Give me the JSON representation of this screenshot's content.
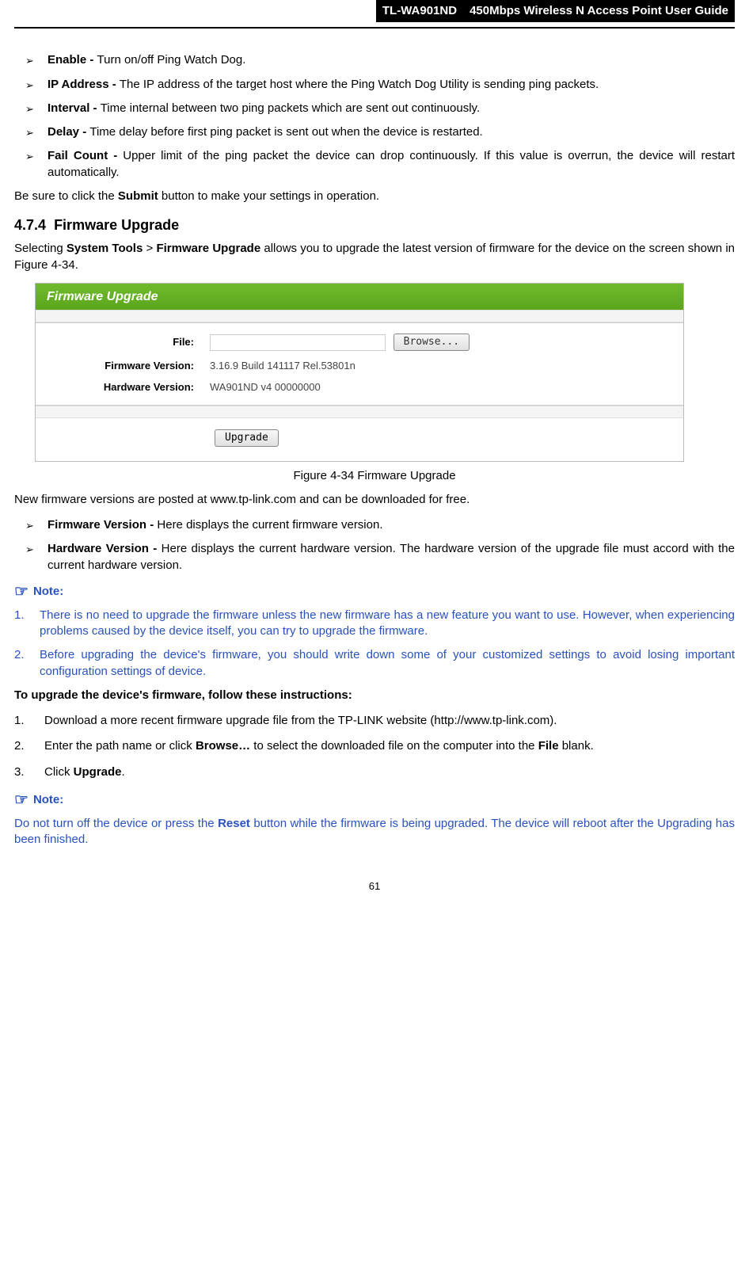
{
  "header": {
    "model": "TL-WA901ND",
    "title": "450Mbps Wireless N Access Point User Guide"
  },
  "bullets1": [
    {
      "term": "Enable - ",
      "desc": "Turn on/off Ping Watch Dog."
    },
    {
      "term": "IP Address - ",
      "desc": "The IP address of the target host where the Ping Watch Dog Utility is sending ping packets."
    },
    {
      "term": "Interval - ",
      "desc": "Time internal between two ping packets which are sent out continuously."
    },
    {
      "term": "Delay - ",
      "desc": "Time delay before first ping packet is sent out when the device is restarted."
    },
    {
      "term": "Fail Count - ",
      "desc": "Upper limit of the ping packet the device can drop continuously. If this value is overrun, the device will restart automatically."
    }
  ],
  "submit_line_a": "Be sure to click the ",
  "submit_bold": "Submit",
  "submit_line_b": " button to make your settings in operation.",
  "section_num": "4.7.4",
  "section_title": "Firmware Upgrade",
  "intro_a": "Selecting ",
  "intro_b": "System Tools",
  "intro_c": " > ",
  "intro_d": "Firmware Upgrade",
  "intro_e": " allows you to upgrade the latest version of firmware for the device on the screen shown in Figure 4-34.",
  "figure": {
    "panel_title": "Firmware Upgrade",
    "file_label": "File:",
    "browse_btn": "Browse...",
    "fw_label": "Firmware Version:",
    "fw_value": "3.16.9 Build 141117 Rel.53801n",
    "hw_label": "Hardware Version:",
    "hw_value": "WA901ND v4 00000000",
    "upgrade_btn": "Upgrade",
    "caption": "Figure 4-34 Firmware Upgrade"
  },
  "after_fig": "New firmware versions are posted at www.tp-link.com and can be downloaded for free.",
  "bullets2": [
    {
      "term": "Firmware Version - ",
      "desc": "Here displays the current firmware version."
    },
    {
      "term": "Hardware Version - ",
      "desc": "Here displays the current hardware version. The hardware version of the upgrade file must accord with the current hardware version."
    }
  ],
  "note_label": "Note:",
  "notes1": [
    "There is no need to upgrade the firmware unless the new firmware has a new feature you want to use. However, when experiencing problems caused by the device itself, you can try to upgrade the firmware.",
    "Before upgrading the device's firmware, you should write down some of your customized settings to avoid losing important configuration settings of device."
  ],
  "instructions_title": "To upgrade the device's firmware, follow these instructions:",
  "steps": [
    {
      "pre": "Download a more recent firmware upgrade file from the TP-LINK website (http://www.tp-link.com)."
    },
    {
      "pre": "Enter the path name or click ",
      "b1": "Browse…",
      "mid": " to select the downloaded file on the computer into the ",
      "b2": "File",
      "post": " blank."
    },
    {
      "pre": "Click ",
      "b1": "Upgrade",
      "post": "."
    }
  ],
  "note2_a": "Do not turn off the device or press the ",
  "note2_bold": "Reset",
  "note2_b": " button while the firmware is being upgraded. The device will reboot after the Upgrading has been finished.",
  "page_number": "61"
}
